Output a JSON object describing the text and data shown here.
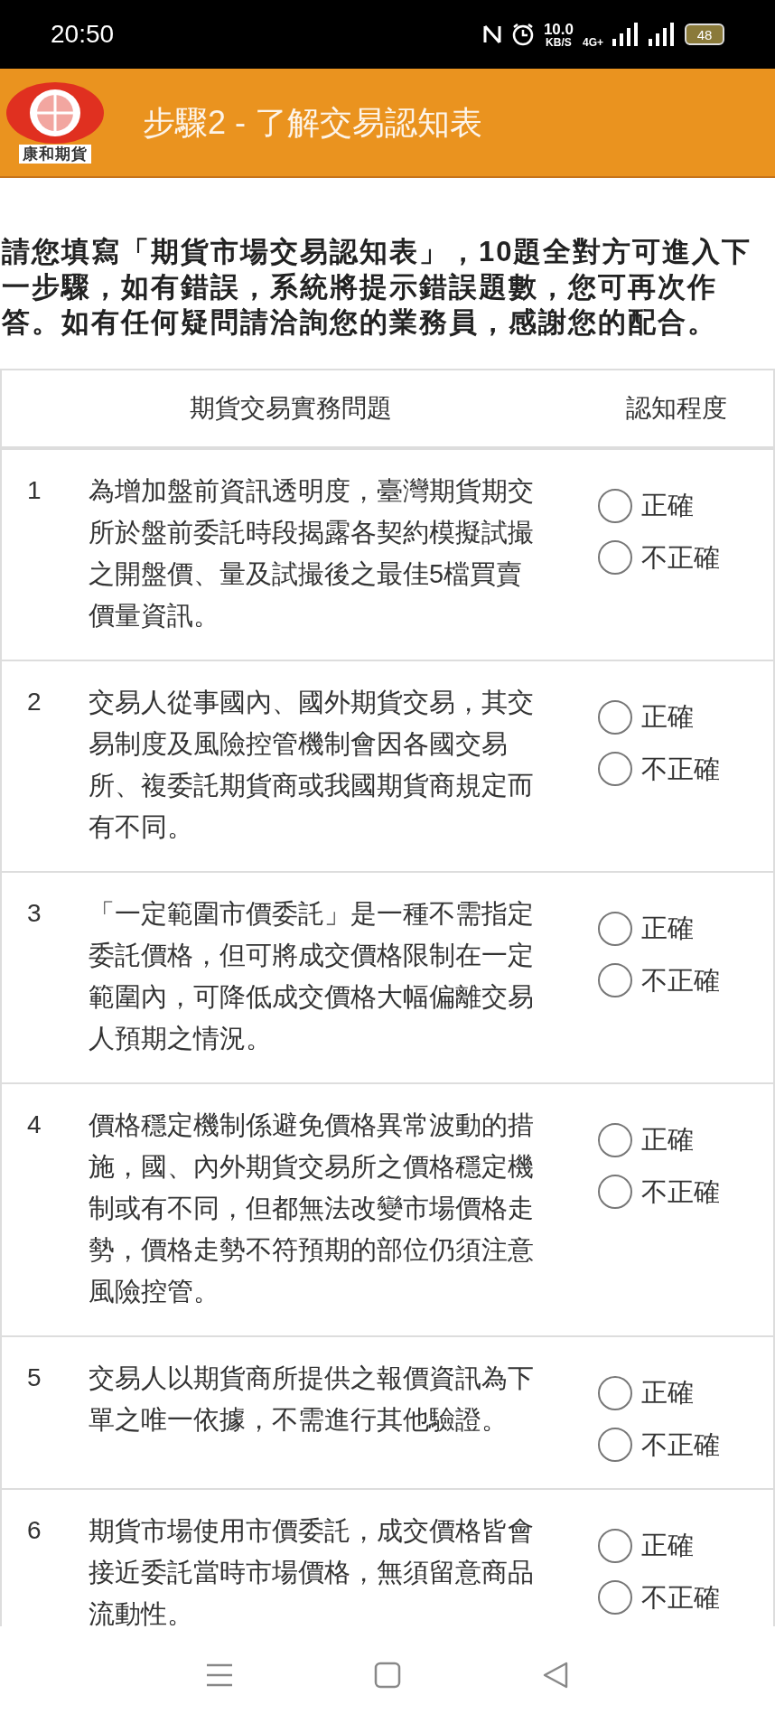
{
  "status_bar": {
    "time": "20:50",
    "net_speed": "10.0",
    "net_unit": "KB/S",
    "network": "4G+",
    "battery": "48"
  },
  "header": {
    "logo_text": "康和期貨",
    "title": "步驟2 - 了解交易認知表"
  },
  "intro": "請您填寫「期貨市場交易認知表」，10題全對方可進入下一步驟，如有錯誤，系統將提示錯誤題數，您可再次作答。如有任何疑問請洽詢您的業務員，感謝您的配合。",
  "table": {
    "columns": [
      "期貨交易實務問題",
      "認知程度"
    ],
    "rows": [
      {
        "number": "1",
        "question": "為增加盤前資訊透明度，臺灣期貨期交所於盤前委託時段揭露各契約模擬試撮之開盤價、量及試撮後之最佳5檔買賣價量資訊。",
        "options": [
          {
            "label": "正確",
            "selected": false
          },
          {
            "label": "不正確",
            "selected": false
          }
        ]
      },
      {
        "number": "2",
        "question": "交易人從事國內、國外期貨交易，其交易制度及風險控管機制會因各國交易所、複委託期貨商或我國期貨商規定而有不同。",
        "options": [
          {
            "label": "正確",
            "selected": false
          },
          {
            "label": "不正確",
            "selected": false
          }
        ]
      },
      {
        "number": "3",
        "question": "「一定範圍市價委託」是一種不需指定委託價格，但可將成交價格限制在一定範圍內，可降低成交價格大幅偏離交易人預期之情況。",
        "options": [
          {
            "label": "正確",
            "selected": false
          },
          {
            "label": "不正確",
            "selected": false
          }
        ]
      },
      {
        "number": "4",
        "question": "價格穩定機制係避免價格異常波動的措施，國、內外期貨交易所之價格穩定機制或有不同，但都無法改變市場價格走勢，價格走勢不符預期的部位仍須注意風險控管。",
        "options": [
          {
            "label": "正確",
            "selected": false
          },
          {
            "label": "不正確",
            "selected": false
          }
        ]
      },
      {
        "number": "5",
        "question": "交易人以期貨商所提供之報價資訊為下單之唯一依據，不需進行其他驗證。",
        "options": [
          {
            "label": "正確",
            "selected": false
          },
          {
            "label": "不正確",
            "selected": false
          }
        ]
      },
      {
        "number": "6",
        "question": "期貨市場使用市價委託，成交價格皆會接近委託當時市場價格，無須留意商品流動性。",
        "options": [
          {
            "label": "正確",
            "selected": false
          },
          {
            "label": "不正確",
            "selected": false
          }
        ]
      }
    ]
  }
}
